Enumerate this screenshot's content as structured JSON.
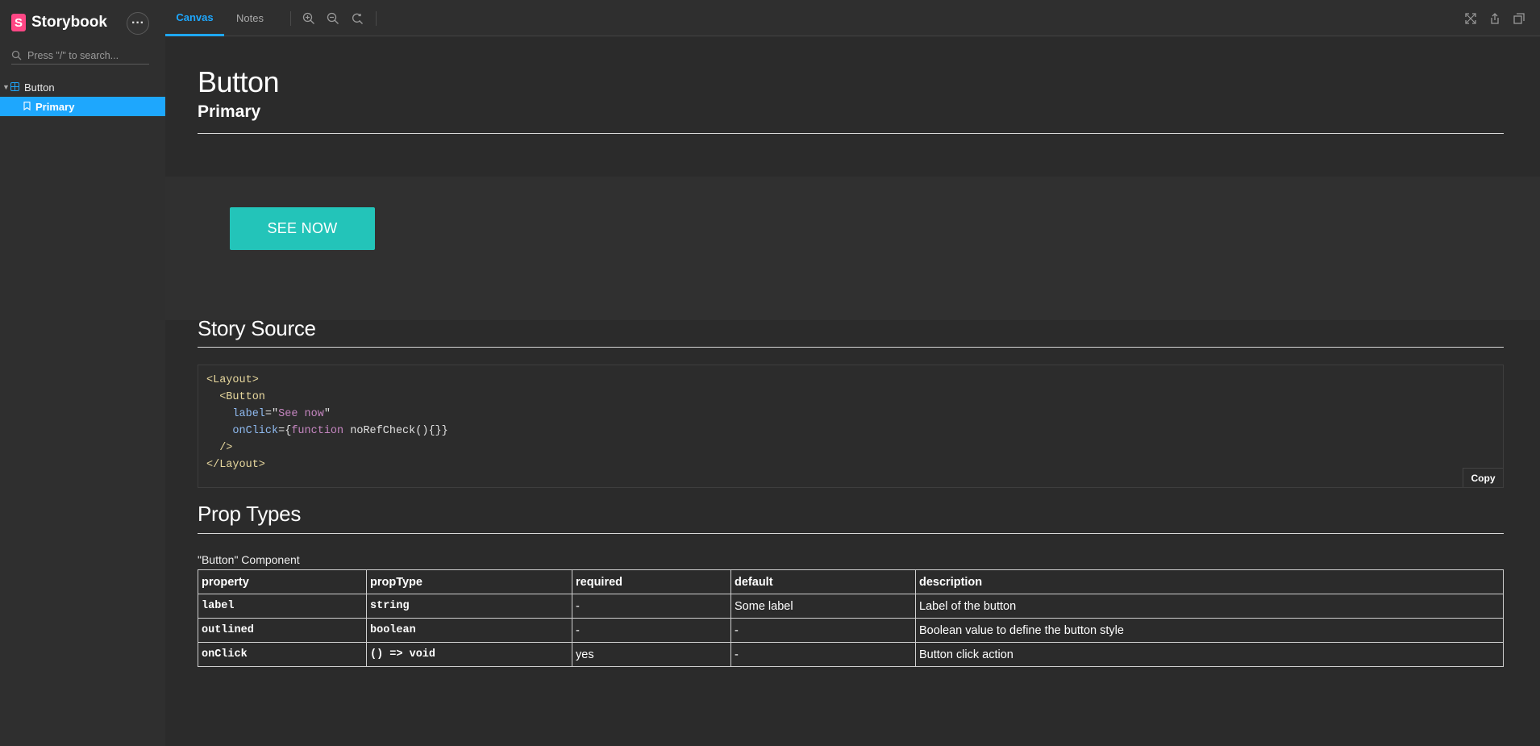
{
  "app": {
    "name": "Storybook"
  },
  "colors": {
    "accent": "#1ea7fd",
    "brand": "#ff4785",
    "button": "#23c4b9"
  },
  "sidebar": {
    "search_placeholder": "Press \"/\" to search...",
    "tree": [
      {
        "label": "Button",
        "icon": "component-icon",
        "expanded": true
      },
      {
        "label": "Primary",
        "icon": "bookmark-icon",
        "selected": true
      }
    ]
  },
  "toolbar": {
    "tabs": [
      {
        "label": "Canvas",
        "active": true
      },
      {
        "label": "Notes",
        "active": false
      }
    ],
    "tools": [
      "zoom-in-icon",
      "zoom-out-icon",
      "reset-zoom-icon"
    ],
    "right_tools": [
      "fullscreen-icon",
      "share-icon",
      "open-new-tab-icon"
    ]
  },
  "main": {
    "title": "Button",
    "subtitle": "Primary",
    "preview": {
      "button_label": "SEE NOW"
    },
    "story_source": {
      "title": "Story Source",
      "copy_label": "Copy"
    },
    "prop_types": {
      "title": "Prop Types",
      "component_label": "\"Button\" Component",
      "headers": [
        "property",
        "propType",
        "required",
        "default",
        "description"
      ],
      "rows": [
        [
          "label",
          "string",
          "-",
          "Some label",
          "Label of the button"
        ],
        [
          "outlined",
          "boolean",
          "-",
          "-",
          "Boolean value to define the button style"
        ],
        [
          "onClick",
          "() => void",
          "yes",
          "-",
          "Button click action"
        ]
      ]
    }
  }
}
